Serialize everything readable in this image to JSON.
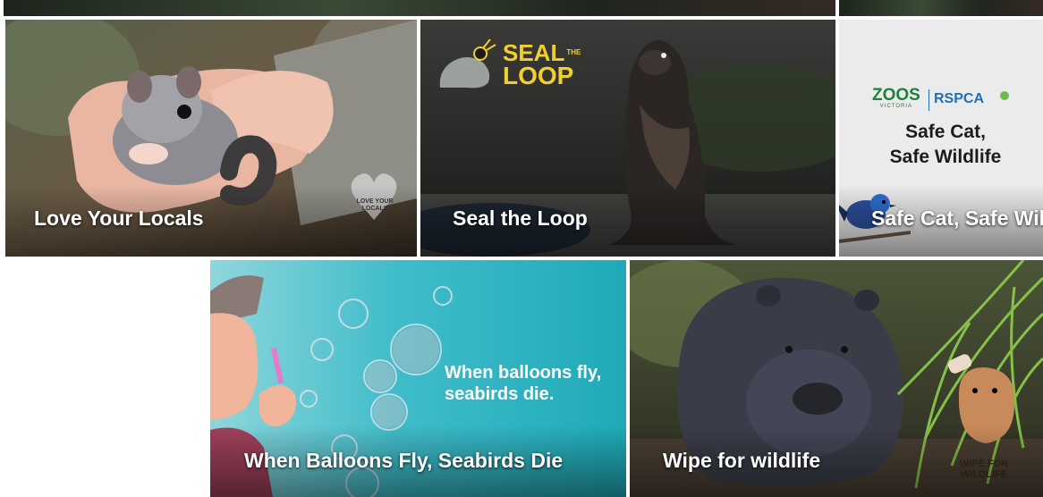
{
  "tiles": [
    {
      "title": "Love Your Locals",
      "badge_text": "LOVE YOUR LOCALS"
    },
    {
      "title": "Seal the Loop",
      "logo": {
        "line1": "SEAL",
        "small": "THE",
        "line2": "LOOP"
      }
    },
    {
      "title": "Safe Cat, Safe Wildlife",
      "partner_left": "ZOOS",
      "partner_left_sub": "VICTORIA",
      "partner_right": "RSPCA",
      "headline_line1": "Safe Cat,",
      "headline_line2": "Safe Wildlife"
    },
    {
      "title": "When Balloons Fly, Seabirds Die",
      "slogan_line1": "When balloons fly,",
      "slogan_line2": "seabirds die."
    },
    {
      "title": "Wipe for wildlife",
      "logo_text": "WIPE FOR WILDLIFE"
    }
  ],
  "colors": {
    "seal_logo_yellow": "#f2cf2b",
    "seal_bg": "#2e2f2c",
    "zoos_green": "#1f7f3f",
    "rspca_blue": "#1f6fb7",
    "balloon_teal": "#36b8c6",
    "wombat_bg": "#3b3d2a"
  }
}
